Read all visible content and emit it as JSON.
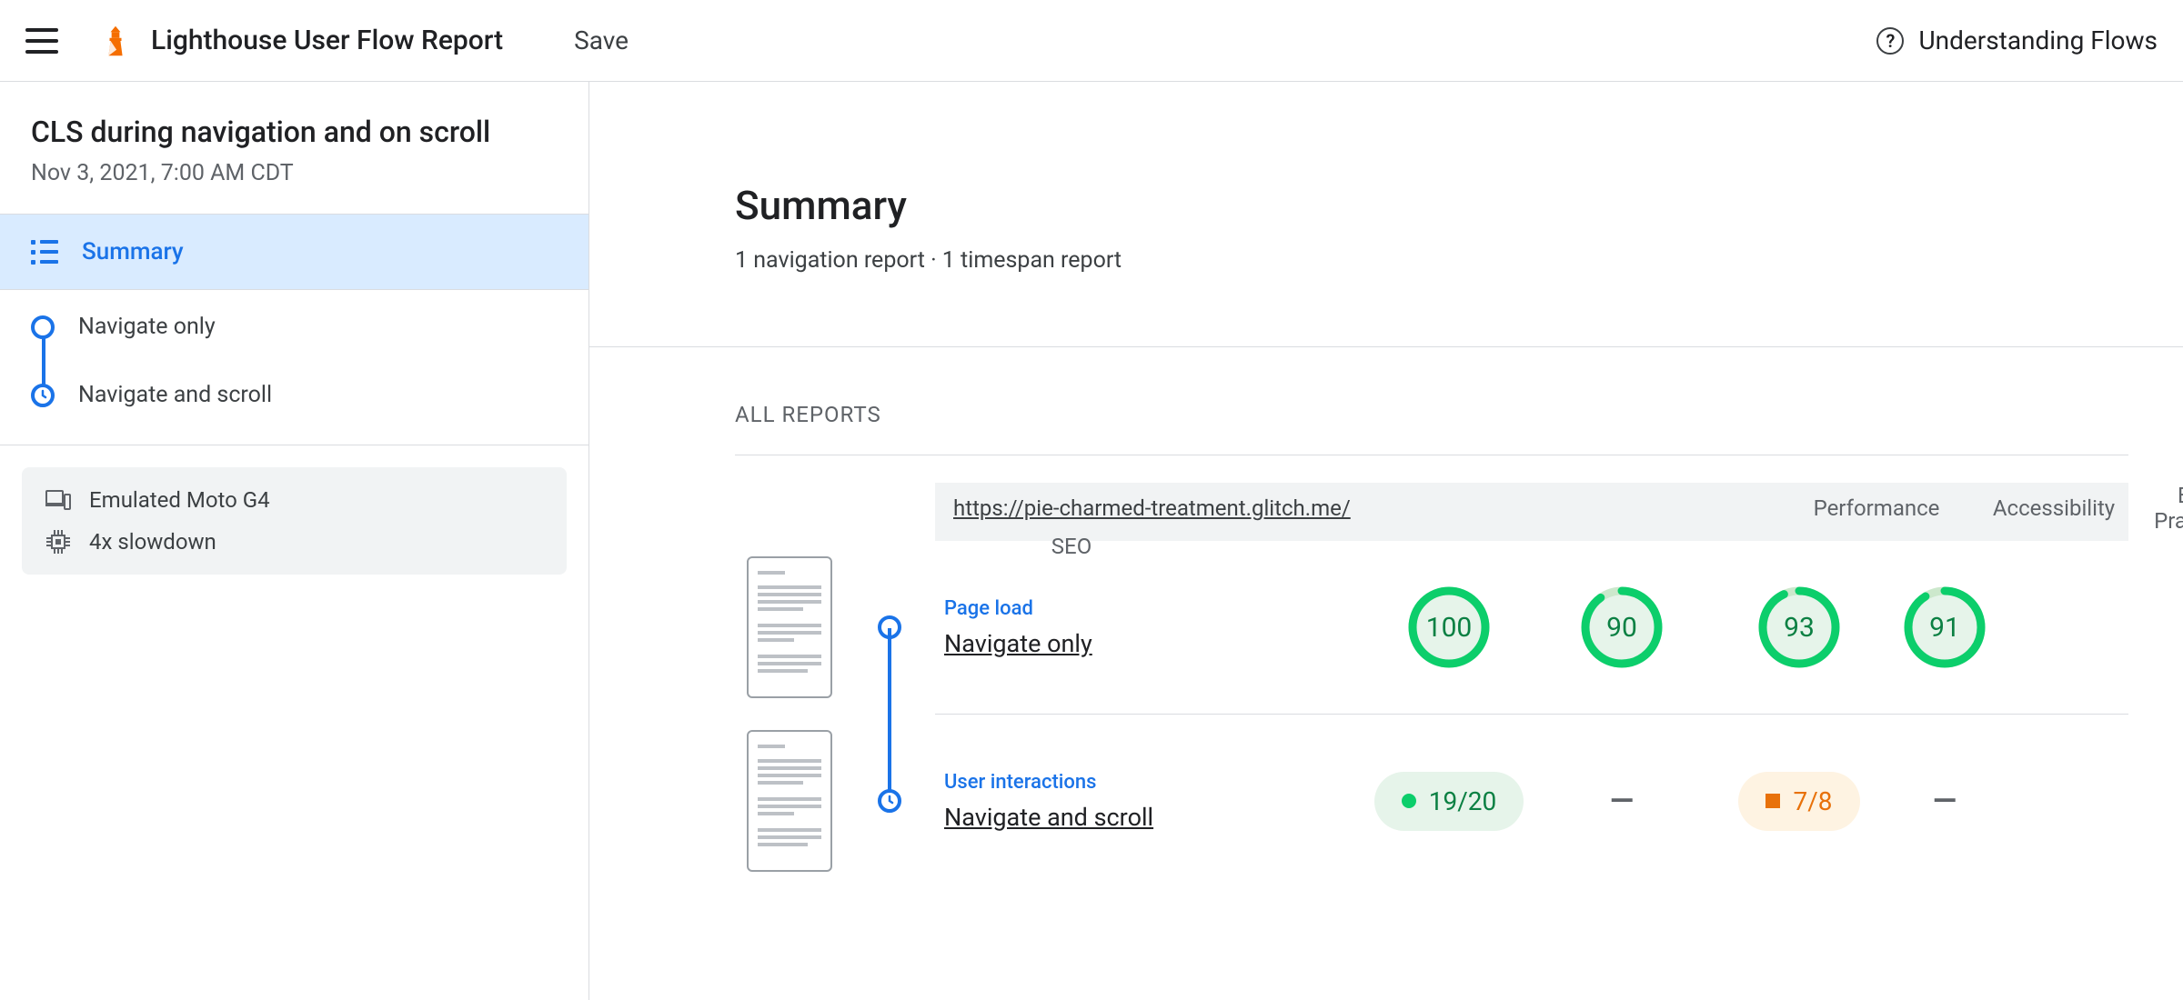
{
  "topbar": {
    "app_title": "Lighthouse User Flow Report",
    "save": "Save",
    "help_link": "Understanding Flows"
  },
  "sidebar": {
    "flow_title": "CLS during navigation and on scroll",
    "flow_date": "Nov 3, 2021, 7:00 AM CDT",
    "summary_label": "Summary",
    "steps": [
      {
        "label": "Navigate only",
        "marker": "circle"
      },
      {
        "label": "Navigate and scroll",
        "marker": "clock"
      }
    ],
    "env": {
      "device": "Emulated Moto G4",
      "throttle": "4x slowdown"
    }
  },
  "main": {
    "title": "Summary",
    "subtitle": "1 navigation report · 1 timespan report",
    "reports_label": "ALL REPORTS",
    "url": "https://pie-charmed-treatment.glitch.me/",
    "columns": {
      "perf": "Performance",
      "a11y": "Accessibility",
      "bp": "Best Practices",
      "seo": "SEO"
    },
    "rows": [
      {
        "type_label": "Page load",
        "name": "Navigate only",
        "kind": "navigation",
        "scores": {
          "perf": 100,
          "a11y": 90,
          "bp": 93,
          "seo": 91
        }
      },
      {
        "type_label": "User interactions",
        "name": "Navigate and scroll",
        "kind": "timespan",
        "fractions": {
          "perf": {
            "num": 19,
            "den": 20,
            "rating": "pass"
          },
          "a11y": null,
          "bp": {
            "num": 7,
            "den": 8,
            "rating": "average"
          },
          "seo": null
        }
      }
    ]
  },
  "icons": {
    "hamburger": "hamburger-icon",
    "lighthouse": "lighthouse-icon",
    "help": "help-icon",
    "summary": "summary-list-icon",
    "device": "device-icon",
    "cpu": "cpu-icon",
    "clock": "clock-icon"
  },
  "dash": "—"
}
